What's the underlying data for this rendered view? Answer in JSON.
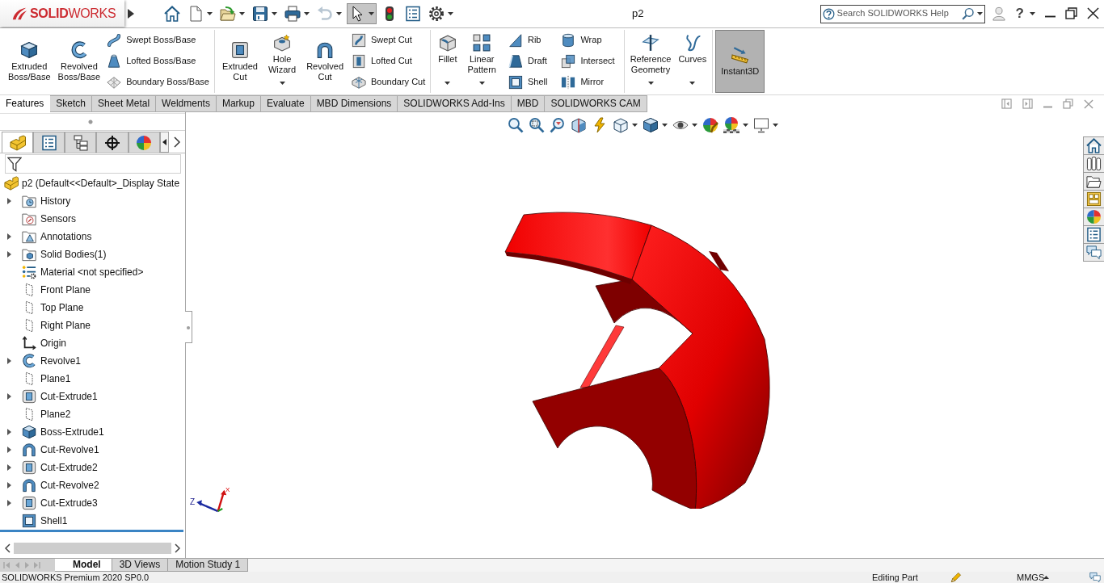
{
  "title_bar": {
    "logo": "**SOLID**WORKS",
    "quick_access": [
      {
        "kind": "home",
        "dropdown": false,
        "disabled": false,
        "selected": false
      },
      {
        "kind": "new",
        "dropdown": true,
        "disabled": false,
        "selected": false
      },
      {
        "kind": "open",
        "dropdown": true,
        "disabled": false,
        "selected": false
      },
      {
        "kind": "save",
        "dropdown": true,
        "disabled": false,
        "selected": false
      },
      {
        "kind": "print",
        "dropdown": true,
        "disabled": false,
        "selected": false
      },
      {
        "kind": "undo",
        "dropdown": true,
        "disabled": true,
        "selected": false
      },
      {
        "kind": "select",
        "dropdown": true,
        "disabled": false,
        "selected": true
      },
      {
        "kind": "rebuild",
        "dropdown": false,
        "disabled": false,
        "selected": false
      },
      {
        "kind": "properties",
        "dropdown": false,
        "disabled": false,
        "selected": false
      },
      {
        "kind": "options",
        "dropdown": true,
        "disabled": false,
        "selected": false
      }
    ],
    "document_title": "p2",
    "search": {
      "placeholder": "Search SOLIDWORKS Help"
    },
    "help": "?"
  },
  "ribbon": {
    "groups": [
      {
        "items": [
          {
            "kind": "large",
            "label": "Extruded Boss/Base",
            "dropdown": false,
            "on": false
          },
          {
            "kind": "large",
            "label": "Revolved Boss/Base",
            "dropdown": false,
            "on": false
          },
          {
            "kind": "column",
            "items": [
              {
                "label": "Swept Boss/Base"
              },
              {
                "label": "Lofted Boss/Base"
              },
              {
                "label": "Boundary Boss/Base"
              }
            ]
          }
        ]
      },
      {
        "items": [
          {
            "kind": "large",
            "label": "Extruded Cut",
            "dropdown": false,
            "on": false
          },
          {
            "kind": "large",
            "label": "Hole Wizard",
            "dropdown": true,
            "on": false
          },
          {
            "kind": "large",
            "label": "Revolved Cut",
            "dropdown": false,
            "on": false
          },
          {
            "kind": "column",
            "items": [
              {
                "label": "Swept Cut"
              },
              {
                "label": "Lofted Cut"
              },
              {
                "label": "Boundary Cut"
              }
            ]
          }
        ]
      },
      {
        "items": [
          {
            "kind": "large",
            "label": "Fillet",
            "dropdown": true,
            "on": false
          },
          {
            "kind": "large",
            "label": "Linear Pattern",
            "dropdown": true,
            "on": false
          },
          {
            "kind": "column",
            "items": [
              {
                "label": "Rib"
              },
              {
                "label": "Draft"
              },
              {
                "label": "Shell"
              }
            ]
          },
          {
            "kind": "column",
            "items": [
              {
                "label": "Wrap"
              },
              {
                "label": "Intersect"
              },
              {
                "label": "Mirror"
              }
            ]
          }
        ]
      },
      {
        "items": [
          {
            "kind": "large",
            "label": "Reference Geometry",
            "dropdown": true,
            "on": false
          },
          {
            "kind": "large",
            "label": "Curves",
            "dropdown": true,
            "on": false
          }
        ]
      },
      {
        "items": [
          {
            "kind": "large",
            "label": "Instant3D",
            "dropdown": false,
            "on": true
          }
        ]
      }
    ]
  },
  "command_tabs": [
    {
      "label": "Features",
      "selected": true
    },
    {
      "label": "Sketch",
      "selected": false
    },
    {
      "label": "Sheet Metal",
      "selected": false
    },
    {
      "label": "Weldments",
      "selected": false
    },
    {
      "label": "Markup",
      "selected": false
    },
    {
      "label": "Evaluate",
      "selected": false
    },
    {
      "label": "MBD Dimensions",
      "selected": false
    },
    {
      "label": "SOLIDWORKS Add-Ins",
      "selected": false
    },
    {
      "label": "MBD",
      "selected": false
    },
    {
      "label": "SOLIDWORKS CAM",
      "selected": false
    }
  ],
  "feature_manager": {
    "tabs": [
      {
        "kind": "features",
        "selected": true
      },
      {
        "kind": "properties",
        "selected": false
      },
      {
        "kind": "configurations",
        "selected": false
      },
      {
        "kind": "dimxpert",
        "selected": false
      },
      {
        "kind": "display",
        "selected": false
      }
    ],
    "root": "p2 (Default<<Default>_Display State",
    "items": [
      {
        "label": "History",
        "kind": "history",
        "expandable": true
      },
      {
        "label": "Sensors",
        "kind": "sensors",
        "expandable": false
      },
      {
        "label": "Annotations",
        "kind": "annotations",
        "expandable": true
      },
      {
        "label": "Solid Bodies(1)",
        "kind": "bodies",
        "expandable": true
      },
      {
        "label": "Material <not specified>",
        "kind": "material",
        "expandable": false
      },
      {
        "label": "Front Plane",
        "kind": "plane",
        "expandable": false
      },
      {
        "label": "Top Plane",
        "kind": "plane",
        "expandable": false
      },
      {
        "label": "Right Plane",
        "kind": "plane",
        "expandable": false
      },
      {
        "label": "Origin",
        "kind": "origin",
        "expandable": false
      },
      {
        "label": "Revolve1",
        "kind": "revolve",
        "expandable": true
      },
      {
        "label": "Plane1",
        "kind": "plane",
        "expandable": false
      },
      {
        "label": "Cut-Extrude1",
        "kind": "cutextrude",
        "expandable": true
      },
      {
        "label": "Plane2",
        "kind": "plane",
        "expandable": false
      },
      {
        "label": "Boss-Extrude1",
        "kind": "extrude",
        "expandable": true
      },
      {
        "label": "Cut-Revolve1",
        "kind": "cutrevolve",
        "expandable": true
      },
      {
        "label": "Cut-Extrude2",
        "kind": "cutextrude",
        "expandable": true
      },
      {
        "label": "Cut-Revolve2",
        "kind": "cutrevolve",
        "expandable": true
      },
      {
        "label": "Cut-Extrude3",
        "kind": "cutextrude",
        "expandable": true
      },
      {
        "label": "Shell1",
        "kind": "shell",
        "expandable": false
      }
    ]
  },
  "graphics_area": {
    "triad_labels": [
      "Z",
      "X"
    ]
  },
  "bottom_tabs": [
    {
      "label": "Model",
      "selected": true
    },
    {
      "label": "3D Views",
      "selected": false
    },
    {
      "label": "Motion Study 1",
      "selected": false
    }
  ],
  "status_bar": {
    "product": "SOLIDWORKS Premium 2020 SP0.0",
    "mode": "Editing Part",
    "units": "MMGS"
  }
}
